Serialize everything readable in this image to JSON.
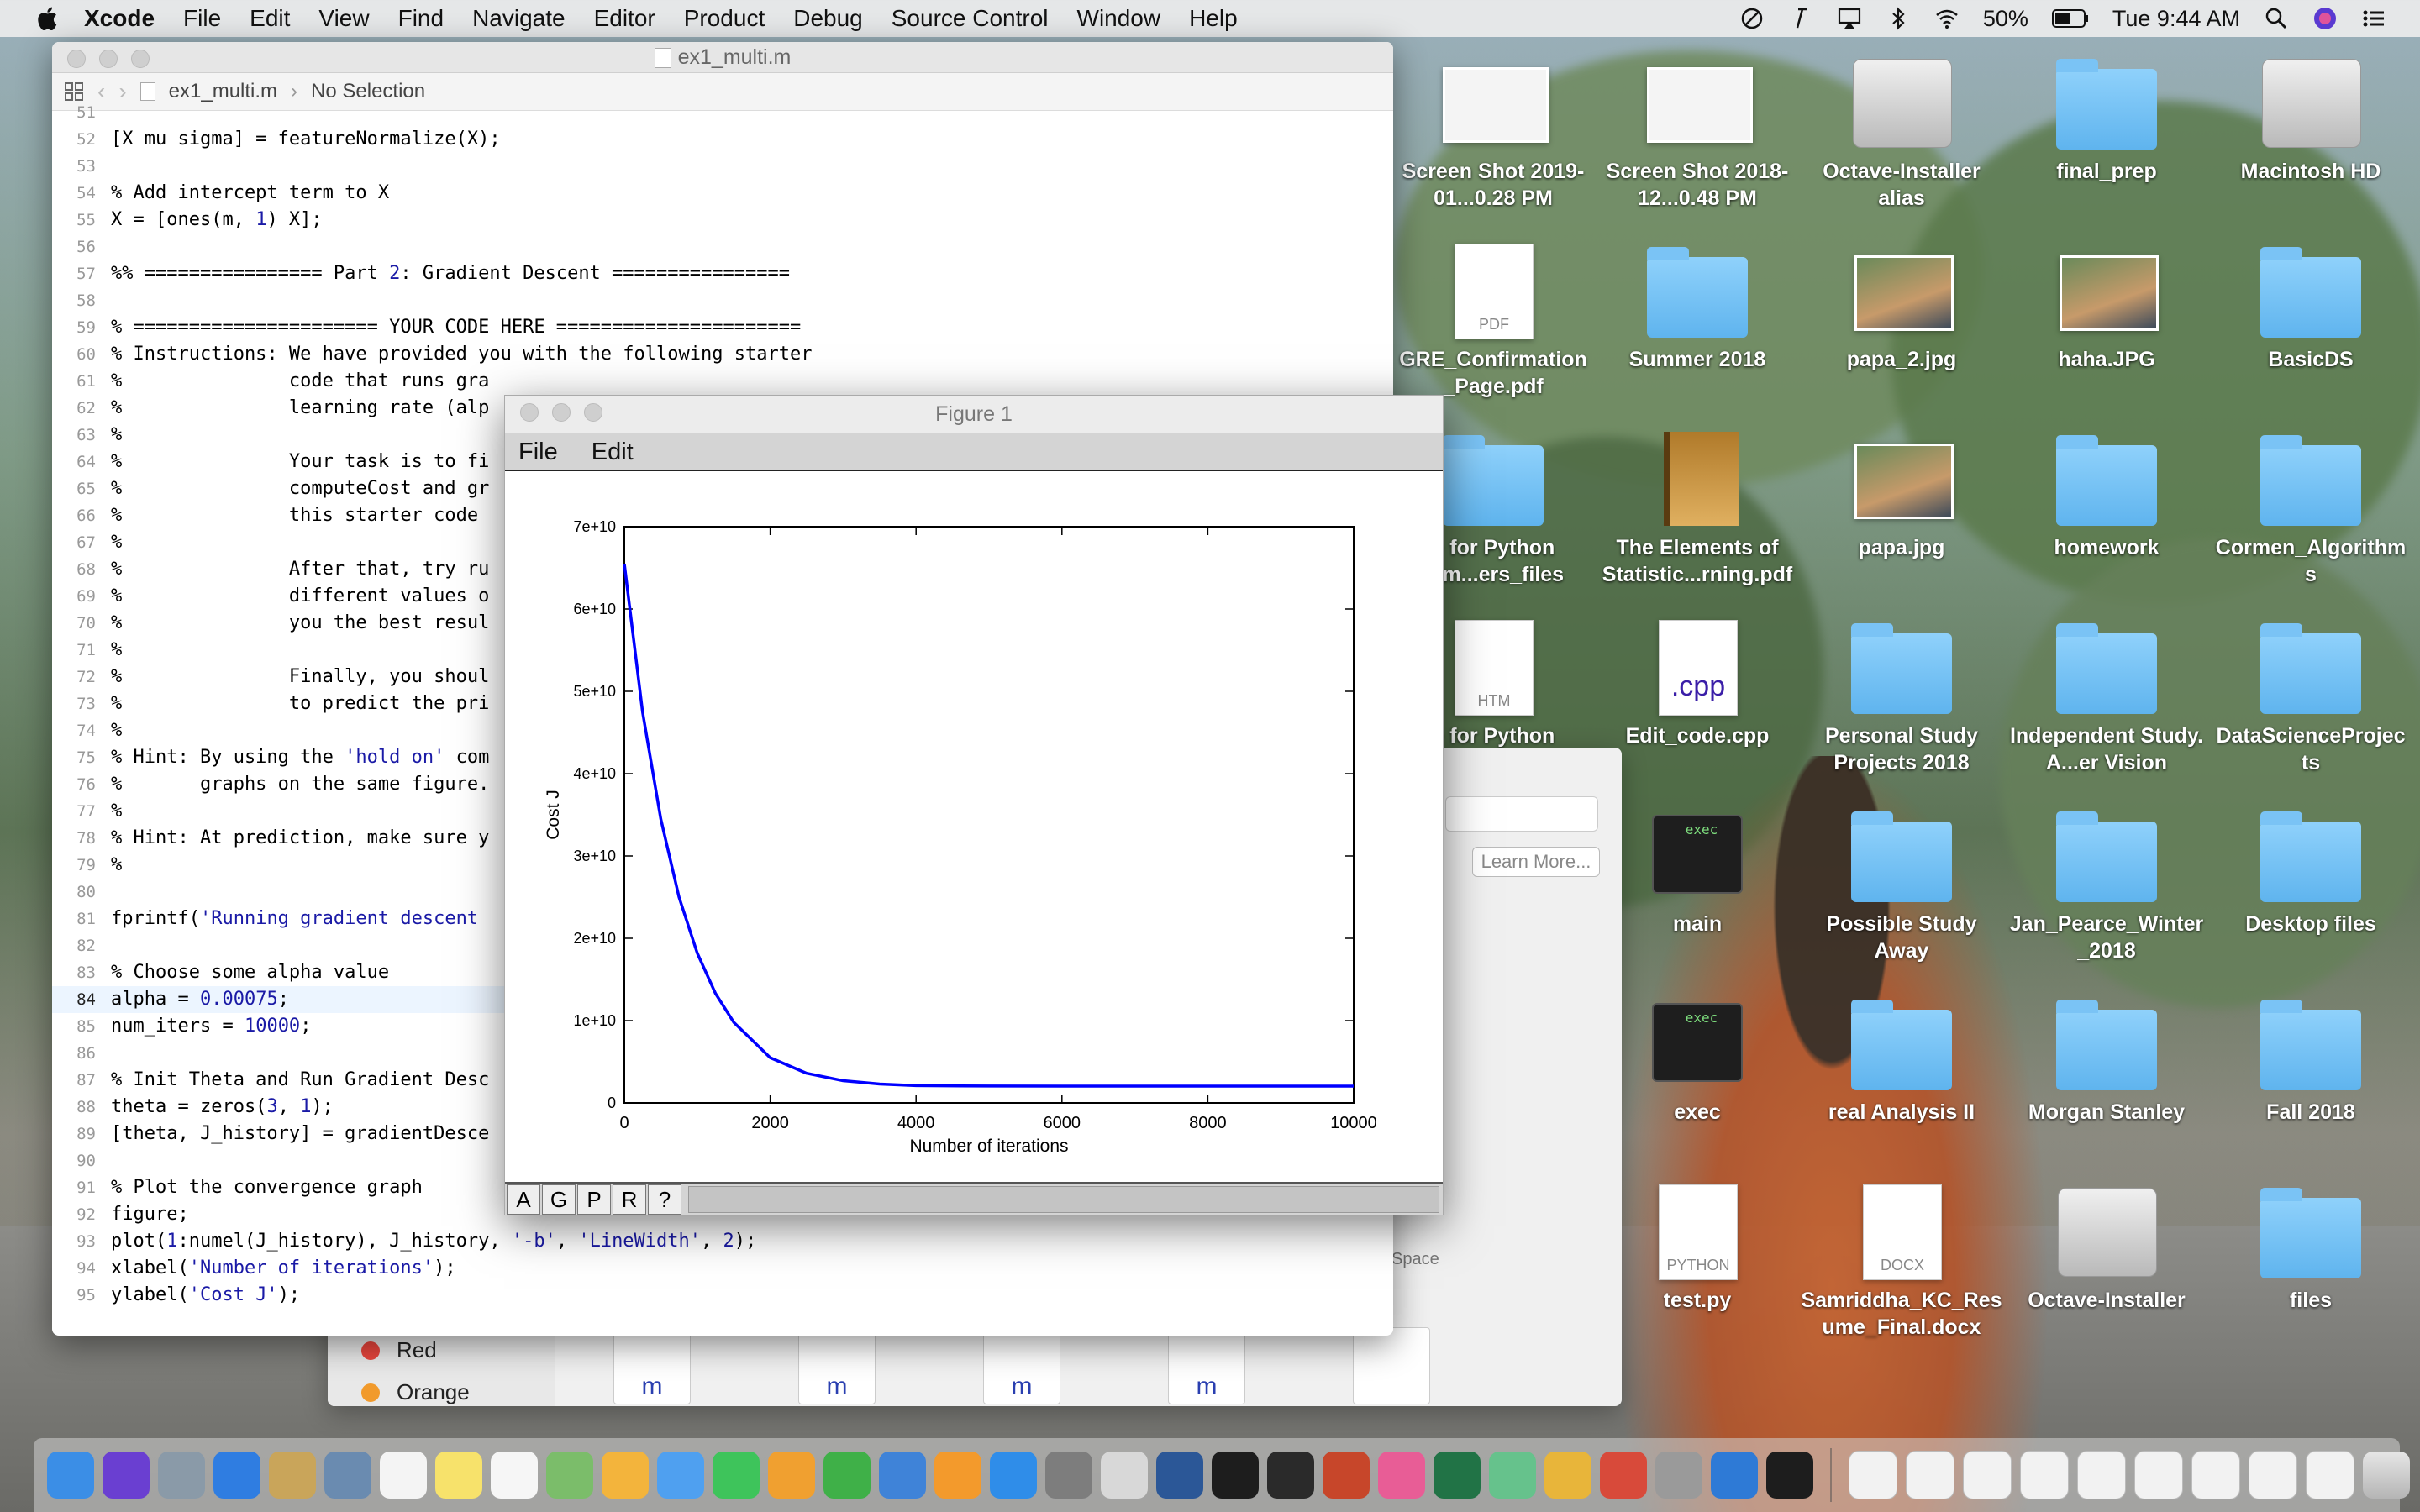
{
  "menubar": {
    "app": "Xcode",
    "items": [
      "File",
      "Edit",
      "View",
      "Find",
      "Navigate",
      "Editor",
      "Product",
      "Debug",
      "Source Control",
      "Window",
      "Help"
    ],
    "battery": "50%",
    "clock": "Tue 9:44 AM"
  },
  "xcode": {
    "title": "ex1_multi.m",
    "jump_file": "ex1_multi.m",
    "jump_sel": "No Selection",
    "lines": [
      {
        "n": "51",
        "t": ""
      },
      {
        "n": "52",
        "t": "[X mu sigma] = featureNormalize(X);"
      },
      {
        "n": "53",
        "t": ""
      },
      {
        "n": "54",
        "t": "% Add intercept term to X"
      },
      {
        "n": "55",
        "t": "X = [ones(m, 1) X];"
      },
      {
        "n": "56",
        "t": ""
      },
      {
        "n": "57",
        "t": "%% ================ Part 2: Gradient Descent ================"
      },
      {
        "n": "58",
        "t": ""
      },
      {
        "n": "59",
        "t": "% ====================== YOUR CODE HERE ======================"
      },
      {
        "n": "60",
        "t": "% Instructions: We have provided you with the following starter"
      },
      {
        "n": "61",
        "t": "%               code that runs gra"
      },
      {
        "n": "62",
        "t": "%               learning rate (alp"
      },
      {
        "n": "63",
        "t": "%"
      },
      {
        "n": "64",
        "t": "%               Your task is to fi"
      },
      {
        "n": "65",
        "t": "%               computeCost and gr"
      },
      {
        "n": "66",
        "t": "%               this starter code"
      },
      {
        "n": "67",
        "t": "%"
      },
      {
        "n": "68",
        "t": "%               After that, try ru"
      },
      {
        "n": "69",
        "t": "%               different values o"
      },
      {
        "n": "70",
        "t": "%               you the best resul"
      },
      {
        "n": "71",
        "t": "%"
      },
      {
        "n": "72",
        "t": "%               Finally, you shoul"
      },
      {
        "n": "73",
        "t": "%               to predict the pri"
      },
      {
        "n": "74",
        "t": "%"
      },
      {
        "n": "75",
        "t": "% Hint: By using the 'hold on' com"
      },
      {
        "n": "76",
        "t": "%       graphs on the same figure."
      },
      {
        "n": "77",
        "t": "%"
      },
      {
        "n": "78",
        "t": "% Hint: At prediction, make sure y"
      },
      {
        "n": "79",
        "t": "%"
      },
      {
        "n": "80",
        "t": ""
      },
      {
        "n": "81",
        "t": "fprintf('Running gradient descent"
      },
      {
        "n": "82",
        "t": ""
      },
      {
        "n": "83",
        "t": "% Choose some alpha value"
      },
      {
        "n": "84",
        "t": "alpha = 0.00075;"
      },
      {
        "n": "85",
        "t": "num_iters = 10000;"
      },
      {
        "n": "86",
        "t": ""
      },
      {
        "n": "87",
        "t": "% Init Theta and Run Gradient Desc"
      },
      {
        "n": "88",
        "t": "theta = zeros(3, 1);"
      },
      {
        "n": "89",
        "t": "[theta, J_history] = gradientDesce"
      },
      {
        "n": "90",
        "t": ""
      },
      {
        "n": "91",
        "t": "% Plot the convergence graph"
      },
      {
        "n": "92",
        "t": "figure;"
      },
      {
        "n": "93",
        "t": "plot(1:numel(J_history), J_history, '-b', 'LineWidth', 2);"
      },
      {
        "n": "94",
        "t": "xlabel('Number of iterations');"
      },
      {
        "n": "95",
        "t": "ylabel('Cost J');"
      }
    ],
    "highlight_line": "84"
  },
  "figure": {
    "title": "Figure 1",
    "menu": [
      "File",
      "Edit"
    ],
    "toolbar": [
      "A",
      "G",
      "P",
      "R",
      "?"
    ]
  },
  "chart_data": {
    "type": "line",
    "title": "",
    "xlabel": "Number of iterations",
    "ylabel": "Cost J",
    "xlim": [
      0,
      10000
    ],
    "ylim": [
      0,
      70000000000
    ],
    "xticks": [
      "0",
      "2000",
      "4000",
      "6000",
      "8000",
      "10000"
    ],
    "yticks": [
      "0",
      "1e+10",
      "2e+10",
      "3e+10",
      "4e+10",
      "5e+10",
      "6e+10",
      "7e+10"
    ],
    "grid": false,
    "color": "#0000ff",
    "series": [
      {
        "x": [
          0,
          250,
          500,
          750,
          1000,
          1250,
          1500,
          2000,
          2500,
          3000,
          3500,
          4000,
          5000,
          6000,
          7000,
          8000,
          9000,
          10000
        ],
        "y": [
          65500000000,
          47500000000,
          34500000000,
          25000000000,
          18200000000,
          13300000000,
          9800000000,
          5500000000,
          3600000000,
          2700000000,
          2300000000,
          2100000000,
          2050000000,
          2040000000,
          2040000000,
          2040000000,
          2040000000,
          2040000000
        ]
      }
    ]
  },
  "dialog": {
    "learn_more": "Learn More...",
    "space": "Space",
    "tags": [
      "Red",
      "Orange"
    ],
    "mfile_letter": "m"
  },
  "desktop": {
    "icons": [
      {
        "label": "Screen Shot 2019-01...0.28 PM",
        "kind": "shot"
      },
      {
        "label": "Screen Shot 2018-12...0.48 PM",
        "kind": "shot"
      },
      {
        "label": "Octave-Installer alias",
        "kind": "disk"
      },
      {
        "label": "final_prep",
        "kind": "folder"
      },
      {
        "label": "Macintosh HD",
        "kind": "disk"
      },
      {
        "label": "GRE_Confirmation _Page.pdf",
        "kind": "doc",
        "ext": "PDF"
      },
      {
        "label": "Summer 2018",
        "kind": "folder"
      },
      {
        "label": "papa_2.jpg",
        "kind": "photo"
      },
      {
        "label": "haha.JPG",
        "kind": "photo"
      },
      {
        "label": "BasicDS",
        "kind": "folder"
      },
      {
        "label": "+ for Python ram...ers_files",
        "kind": "folder"
      },
      {
        "label": "The Elements of Statistic...rning.pdf",
        "kind": "book"
      },
      {
        "label": "papa.jpg",
        "kind": "photo"
      },
      {
        "label": "homework",
        "kind": "folder"
      },
      {
        "label": "Cormen_Algorithm s",
        "kind": "folder"
      },
      {
        "label": "+ for Python",
        "kind": "doc",
        "ext": "HTM"
      },
      {
        "label": "Edit_code.cpp",
        "kind": "doc",
        "ext": ".cpp"
      },
      {
        "label": "Personal Study Projects 2018",
        "kind": "folder"
      },
      {
        "label": "Independent Study. A...er Vision",
        "kind": "folder"
      },
      {
        "label": "DataScienceProjec ts",
        "kind": "folder"
      },
      {
        "label": "main",
        "kind": "exec",
        "ext": "exec"
      },
      {
        "label": "Possible Study Away",
        "kind": "folder"
      },
      {
        "label": "Jan_Pearce_Winter _2018",
        "kind": "folder"
      },
      {
        "label": "Desktop files",
        "kind": "folder"
      },
      {
        "label": "exec",
        "kind": "exec",
        "ext": "exec"
      },
      {
        "label": "real Analysis II",
        "kind": "folder"
      },
      {
        "label": "Morgan Stanley",
        "kind": "folder"
      },
      {
        "label": "Fall 2018",
        "kind": "folder"
      },
      {
        "label": "test.py",
        "kind": "doc",
        "ext": "PYTHON"
      },
      {
        "label": "Samriddha_KC_Res ume_Final.docx",
        "kind": "doc",
        "ext": "DOCX"
      },
      {
        "label": "Octave-Installer",
        "kind": "disk"
      },
      {
        "label": "files",
        "kind": "folder"
      }
    ]
  },
  "dock": {
    "apps": [
      {
        "name": "finder",
        "color": "#3b8ee6"
      },
      {
        "name": "siri",
        "color": "#6a3fd1"
      },
      {
        "name": "launchpad",
        "color": "#8a9aa8"
      },
      {
        "name": "safari",
        "color": "#2f7de1"
      },
      {
        "name": "notes-book",
        "color": "#c9a55a"
      },
      {
        "name": "preview",
        "color": "#6a8bb0"
      },
      {
        "name": "calendar",
        "color": "#f4f4f4"
      },
      {
        "name": "stickies",
        "color": "#f7e26b"
      },
      {
        "name": "reminders",
        "color": "#f6f6f6"
      },
      {
        "name": "maps",
        "color": "#7bbd6a"
      },
      {
        "name": "photos",
        "color": "#f3b43c"
      },
      {
        "name": "messages",
        "color": "#4fa0f0"
      },
      {
        "name": "facetime",
        "color": "#3ec45b"
      },
      {
        "name": "pages",
        "color": "#f0a030"
      },
      {
        "name": "numbers",
        "color": "#3fb048"
      },
      {
        "name": "keynote",
        "color": "#3f83d8"
      },
      {
        "name": "ibooks",
        "color": "#f39a2c"
      },
      {
        "name": "app-store",
        "color": "#2f8de9"
      },
      {
        "name": "system-preferences",
        "color": "#7d7d7d"
      },
      {
        "name": "help",
        "color": "#d8d8d8"
      },
      {
        "name": "word",
        "color": "#2b5797"
      },
      {
        "name": "terminal",
        "color": "#1d1d1d"
      },
      {
        "name": "activity-monitor",
        "color": "#2a2a2a"
      },
      {
        "name": "powerpoint",
        "color": "#c7462a"
      },
      {
        "name": "itunes",
        "color": "#e85d96"
      },
      {
        "name": "excel",
        "color": "#217346"
      },
      {
        "name": "atom",
        "color": "#66c28c"
      },
      {
        "name": "chrome",
        "color": "#e8b53a"
      },
      {
        "name": "app-grid",
        "color": "#d84a3a"
      },
      {
        "name": "disk-utility",
        "color": "#9a9a9a"
      },
      {
        "name": "xcode",
        "color": "#2e7ad6"
      },
      {
        "name": "exec-window",
        "color": "#1d1d1d"
      }
    ],
    "docs_count": 9
  },
  "colors": {
    "accent": "#0000ff",
    "folder": "#6cbcf2",
    "red_tag": "#e8453c",
    "orange_tag": "#f19a2c"
  }
}
